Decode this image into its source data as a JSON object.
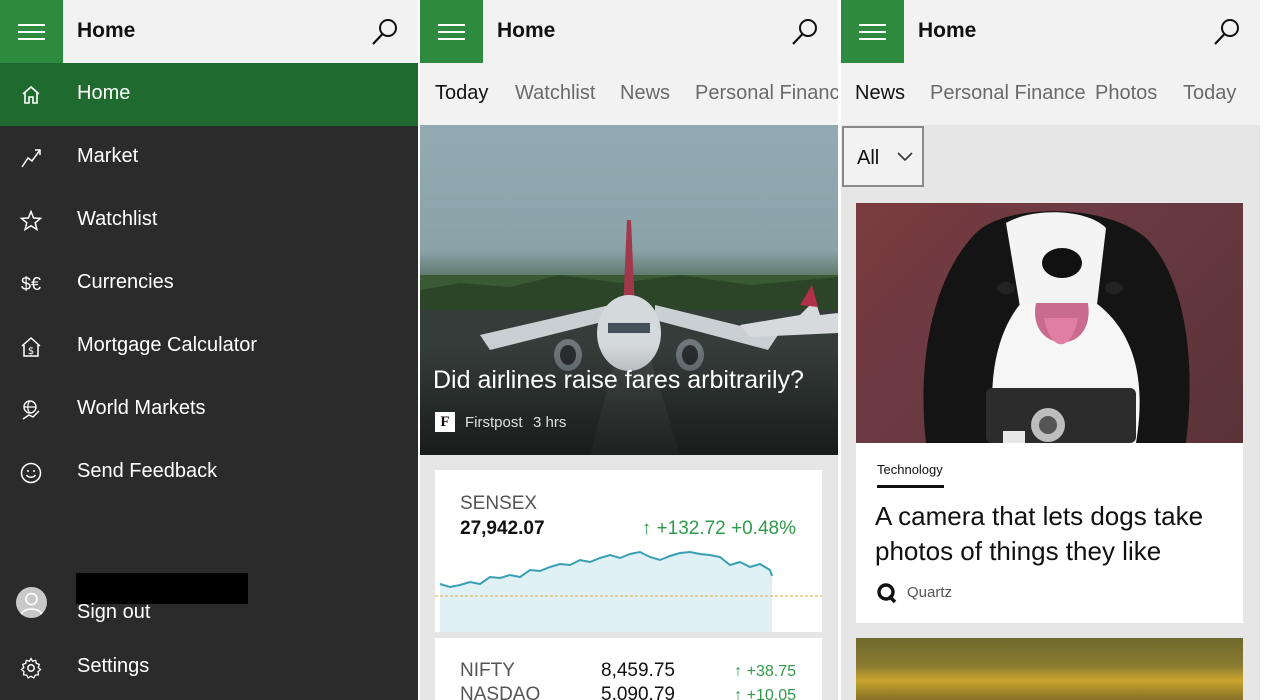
{
  "panes": [
    {
      "header": {
        "title": "Home"
      },
      "nav": [
        {
          "label": "Home",
          "icon": "home-icon"
        },
        {
          "label": "Market",
          "icon": "trend-icon"
        },
        {
          "label": "Watchlist",
          "icon": "star-icon"
        },
        {
          "label": "Currencies",
          "icon": "currency-icon"
        },
        {
          "label": "Mortgage Calculator",
          "icon": "mortgage-icon"
        },
        {
          "label": "World Markets",
          "icon": "globe-icon"
        },
        {
          "label": "Send Feedback",
          "icon": "smiley-icon"
        }
      ],
      "account": {
        "signout_label": "Sign out"
      },
      "settings_label": "Settings"
    },
    {
      "header": {
        "title": "Home"
      },
      "tabs": [
        "Today",
        "Watchlist",
        "News",
        "Personal Finance"
      ],
      "hero": {
        "title": "Did airlines raise fares arbitrarily?",
        "source": "Firstpost",
        "source_logo": "F",
        "time": "3 hrs"
      },
      "market": {
        "name": "SENSEX",
        "value": "27,942.07",
        "change": "↑ +132.72  +0.48%",
        "rows": [
          {
            "name": "NIFTY",
            "value": "8,459.75",
            "change": "↑  +38.75"
          },
          {
            "name": "NASDAQ",
            "value": "5,090.79",
            "change": "↑  +10.05"
          }
        ]
      }
    },
    {
      "header": {
        "title": "Home"
      },
      "tabs": [
        "News",
        "Personal Finance",
        "Photos",
        "Today"
      ],
      "filter": {
        "value": "All"
      },
      "news": {
        "category": "Technology",
        "title": "A camera that lets dogs take photos of things they like",
        "source": "Quartz"
      }
    }
  ],
  "colors": {
    "accent": "#2d8a3e",
    "active_nav": "#1f6b2f",
    "nav_bg": "#2b2b2b",
    "positive": "#2e9a4a"
  }
}
